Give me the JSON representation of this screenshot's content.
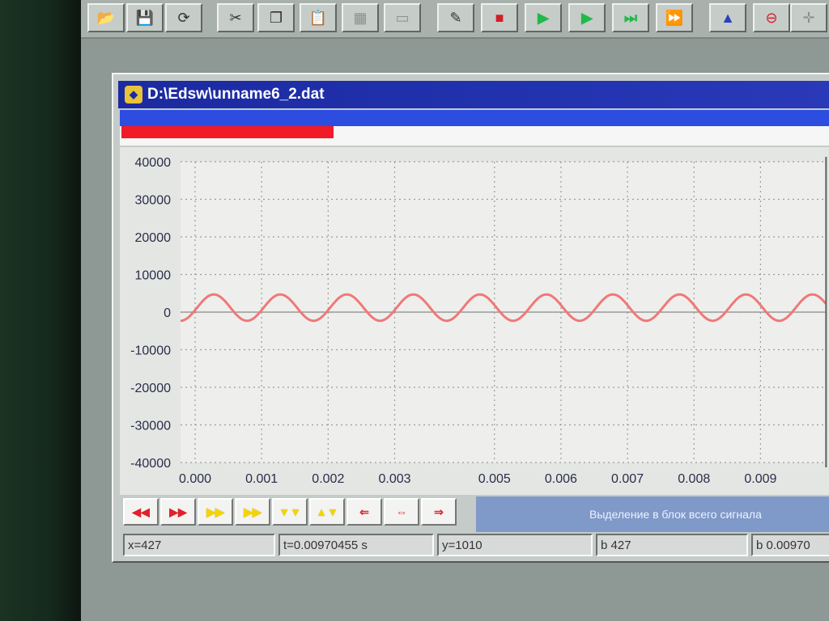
{
  "toolbar": {
    "buttons": [
      {
        "name": "open-icon",
        "glyph": "📂"
      },
      {
        "name": "save-icon",
        "glyph": "💾"
      },
      {
        "name": "refresh-icon",
        "glyph": "⟳"
      },
      {
        "name": "cut-icon",
        "glyph": "✂"
      },
      {
        "name": "copy-icon",
        "glyph": "❐"
      },
      {
        "name": "paste-icon",
        "glyph": "📋"
      },
      {
        "name": "grid-icon",
        "glyph": "▦"
      },
      {
        "name": "disabled-icon",
        "glyph": "▭"
      },
      {
        "name": "probe-icon",
        "glyph": "✎"
      },
      {
        "name": "stop-icon",
        "glyph": "■"
      },
      {
        "name": "play-icon",
        "glyph": "▶"
      },
      {
        "name": "record-play-icon",
        "glyph": "▶"
      },
      {
        "name": "step-forward-icon",
        "glyph": "⏭"
      },
      {
        "name": "fast-play-icon",
        "glyph": "⏩"
      },
      {
        "name": "triangle-icon",
        "glyph": "▲"
      },
      {
        "name": "no-entry-icon",
        "glyph": "⊖"
      },
      {
        "name": "crosshair-icon",
        "glyph": "✛"
      }
    ]
  },
  "window": {
    "title": "D:\\Edsw\\unname6_2.dat"
  },
  "chart_data": {
    "type": "line",
    "title": "",
    "xlabel": "",
    "ylabel": "",
    "ylim": [
      -40000,
      40000
    ],
    "xlim": [
      0,
      0.0097
    ],
    "y_ticks": [
      "40000",
      "30000",
      "20000",
      "10000",
      "0",
      "-10000",
      "-20000",
      "-30000",
      "-40000"
    ],
    "x_ticks": [
      "0.000",
      "0.001",
      "0.002",
      "0.003",
      "0.005",
      "0.006",
      "0.007",
      "0.008",
      "0.009"
    ],
    "x_tick_values": [
      0,
      0.001,
      0.002,
      0.003,
      0.0045,
      0.0055,
      0.0065,
      0.0075,
      0.0085
    ],
    "grid": true,
    "series": [
      {
        "color": "#f07878",
        "amplitude": 3500,
        "offset": 1200,
        "cycles_per_second": 1000,
        "phase": 0.75
      }
    ],
    "cursor_x": 0.00970455
  },
  "navigation": {
    "buttons": [
      {
        "name": "rewind-button",
        "glyph": "◀◀",
        "color": "red"
      },
      {
        "name": "forward-button",
        "glyph": "▶▶",
        "color": "red"
      },
      {
        "name": "fast-right-button",
        "glyph": "▶▶",
        "color": "yel"
      },
      {
        "name": "fast-right-2-button",
        "glyph": "▶▶",
        "color": "yel"
      },
      {
        "name": "zoom-y-in-button",
        "glyph": "▼▼",
        "color": "yel"
      },
      {
        "name": "zoom-y-out-button",
        "glyph": "▲▼",
        "color": "yel"
      },
      {
        "name": "shift-left-button",
        "glyph": "⇐",
        "color": "red"
      },
      {
        "name": "shift-center-button",
        "glyph": "⇔",
        "color": "red"
      },
      {
        "name": "shift-right-button",
        "glyph": "⇒",
        "color": "red"
      }
    ],
    "status_message": "Выделение в блок всего сигнала"
  },
  "statusbar": {
    "x": "x=427",
    "t": "t=0.00970455 s",
    "y": "y=1010",
    "b1": "b 427",
    "b2": "b 0.00970"
  }
}
